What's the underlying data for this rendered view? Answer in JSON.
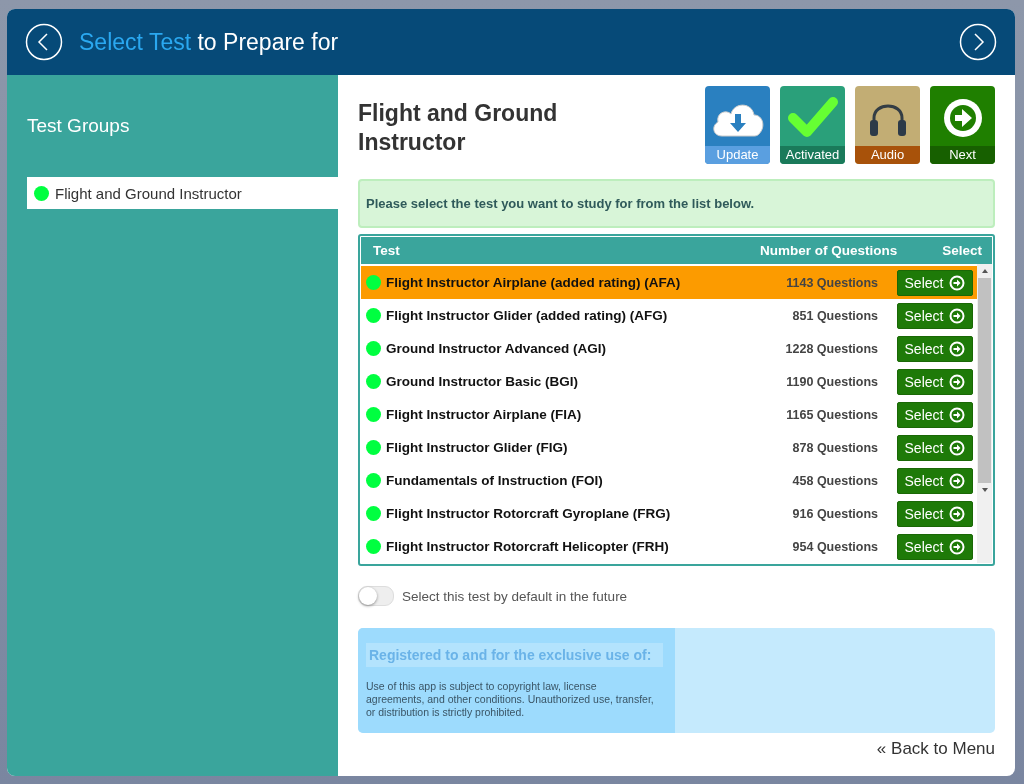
{
  "header": {
    "title_highlight": "Select Test",
    "title_rest": "to Prepare for"
  },
  "sidebar": {
    "title": "Test Groups",
    "items": [
      {
        "label": "Flight and Ground Instructor",
        "selected": true,
        "color": "#00ff40"
      }
    ]
  },
  "content": {
    "heading": "Flight and Ground Instructor",
    "tools": [
      {
        "kind": "update",
        "label": "Update"
      },
      {
        "kind": "activated",
        "label": "Activated"
      },
      {
        "kind": "audio",
        "label": "Audio"
      },
      {
        "kind": "next",
        "label": "Next"
      }
    ],
    "notice": "Please select the test you want to study for from the list below.",
    "table": {
      "columns": [
        "Test",
        "Number of Questions",
        "Select"
      ],
      "rows": [
        {
          "name": "Flight Instructor Airplane (added rating) (AFA)",
          "count": "1143 Questions",
          "button": "Select",
          "selected": true,
          "color": "#00ff40"
        },
        {
          "name": "Flight Instructor Glider (added rating) (AFG)",
          "count": "851 Questions",
          "button": "Select",
          "selected": false,
          "color": "#00ff40"
        },
        {
          "name": "Ground Instructor Advanced (AGI)",
          "count": "1228 Questions",
          "button": "Select",
          "selected": false,
          "color": "#00ff40"
        },
        {
          "name": "Ground Instructor Basic (BGI)",
          "count": "1190 Questions",
          "button": "Select",
          "selected": false,
          "color": "#00ff40"
        },
        {
          "name": "Flight Instructor Airplane (FIA)",
          "count": "1165 Questions",
          "button": "Select",
          "selected": false,
          "color": "#00ff40"
        },
        {
          "name": "Flight Instructor Glider (FIG)",
          "count": "878 Questions",
          "button": "Select",
          "selected": false,
          "color": "#00ff40"
        },
        {
          "name": "Fundamentals of Instruction (FOI)",
          "count": "458 Questions",
          "button": "Select",
          "selected": false,
          "color": "#00ff40"
        },
        {
          "name": "Flight Instructor Rotorcraft Gyroplane (FRG)",
          "count": "916 Questions",
          "button": "Select",
          "selected": false,
          "color": "#00ff40"
        },
        {
          "name": "Flight Instructor Rotorcraft Helicopter (FRH)",
          "count": "954 Questions",
          "button": "Select",
          "selected": false,
          "color": "#00ff40"
        }
      ]
    },
    "default_toggle": {
      "label": "Select this test by default in the future",
      "on": false
    },
    "registration": {
      "heading": "Registered to and for the exclusive use of:",
      "notice": "Use of this app is subject to copyright law, license agreements, and other conditions. Unauthorized use, transfer, or distribution is strictly prohibited."
    },
    "back_link": {
      "icon": "«",
      "label": "Back to Menu"
    }
  }
}
